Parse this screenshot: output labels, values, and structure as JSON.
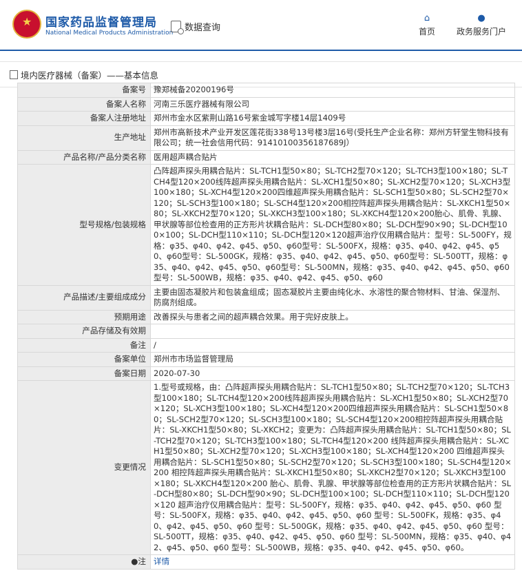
{
  "header": {
    "brand_cn": "国家药品监督管理局",
    "brand_en": "National Medical Products Administration",
    "query_label": "数据查询",
    "nav_home": "首页",
    "nav_service": "政务服务门户"
  },
  "breadcrumb": {
    "text": "境内医疗器械（备案）——基本信息"
  },
  "rows": [
    {
      "label": "备案号",
      "value": "豫郑械备20200196号"
    },
    {
      "label": "备案人名称",
      "value": "河南三乐医疗器械有限公司"
    },
    {
      "label": "备案人注册地址",
      "value": "郑州市金水区紫荆山路16号紫金城写字楼14层1409号"
    },
    {
      "label": "生产地址",
      "value": "郑州市高新技术产业开发区莲花街338号13号楼3层16号(受托生产企业名称：郑州方轩堂生物科技有限公司；统一社会信用代码：91410100356187689J）"
    },
    {
      "label": "产品名称/产品分类名称",
      "value": "医用超声耦合贴片"
    },
    {
      "label": "型号规格/包装规格",
      "value": "凸阵超声探头用耦合贴片：SL-TCH1型50×80；SL-TCH2型70×120；SL-TCH3型100×180；SL-TCH4型120×200线阵超声探头用耦合贴片：SL-XCH1型50×80；SL-XCH2型70×120；SL-XCH3型100×180；SL-XCH4型120×200四维超声探头用耦合贴片：SL-SCH1型50×80；SL-SCH2型70×120；SL-SCH3型100×180；SL-SCH4型120×200相控阵超声探头用耦合贴片：SL-XKCH1型50×80；SL-XKCH2型70×120；SL-XKCH3型100×180；SL-XKCH4型120×200胎心、肌骨、乳腺、甲状腺等部位检查用的正方形片状耦合贴片：SL-DCH型80×80；SL-DCH型90×90；SL-DCH型100×100；SL-DCH型110×110；SL-DCH型120×120超声治疗仪用耦合贴片：型号：SL-500FY，规格：φ35、φ40、φ42、φ45、φ50、φ60型号：SL-500FX，规格：φ35、φ40、φ42、φ45、φ50、φ60型号：SL-500GK，规格：φ35、φ40、φ42、φ45、φ50、φ60型号：SL-500TT，规格：φ35、φ40、φ42、φ45、φ50、φ60型号：SL-500MN，规格：φ35、φ40、φ42、φ45、φ50、φ60型号：SL-500WB，规格：φ35、φ40、φ42、φ45、φ50、φ60"
    },
    {
      "label": "产品描述/主要组成成分",
      "value": "主要由固态凝胶片和包装盒组成；固态凝胶片主要由纯化水、水溶性的聚合物材料、甘油、保湿剂、防腐剂组成。"
    },
    {
      "label": "预期用途",
      "value": "改善探头与患者之间的超声耦合效果。用于完好皮肤上。"
    },
    {
      "label": "产品存储及有效期",
      "value": ""
    },
    {
      "label": "备注",
      "value": "/"
    },
    {
      "label": "备案单位",
      "value": "郑州市市场监督管理局"
    },
    {
      "label": "备案日期",
      "value": "2020-07-30"
    },
    {
      "label": "变更情况",
      "value": "1.型号或规格，由：凸阵超声探头用耦合贴片：SL-TCH1型50×80；SL-TCH2型70×120；SL-TCH3型100×180；SL-TCH4型120×200线阵超声探头用耦合贴片：SL-XCH1型50×80；SL-XCH2型70×120；SL-XCH3型100×180；SL-XCH4型120×200四维超声探头用耦合贴片：SL-SCH1型50×80；SL-SCH2型70×120；SL-SCH3型100×180；SL-SCH4型120×200相控阵超声探头用耦合贴片：SL-XKCH1型50×80；SL-XKCH2；变更为：凸阵超声探头用耦合贴片：SL-TCH1型50×80；SL-TCH2型70×120；SL-TCH3型100×180；SL-TCH4型120×200 线阵超声探头用耦合贴片：SL-XCH1型50×80；SL-XCH2型70×120；SL-XCH3型100×180；SL-XCH4型120×200 四维超声探头用耦合贴片：SL-SCH1型50×80；SL-SCH2型70×120；SL-SCH3型100×180；SL-SCH4型120×200 相控阵超声探头用耦合贴片：SL-XKCH1型50×80；SL-XKCH2型70×120；SL-XKCH3型100×180；SL-XKCH4型120×200 胎心、肌骨、乳腺、甲状腺等部位检查用的正方形片状耦合贴片：SL-DCH型80×80；SL-DCH型90×90；SL-DCH型100×100；SL-DCH型110×110；SL-DCH型120×120 超声治疗仪用耦合贴片：型号：SL-500FY，规格：φ35、φ40、φ42、φ45、φ50、φ60 型号：SL-500FX，规格：φ35、φ40、φ42、φ45、φ50、φ60 型号：SL-500FK，规格：φ35、φ40、φ42、φ45、φ50、φ60 型号：SL-500GK，规格：φ35、φ40、φ42、φ45、φ50、φ60 型号：SL-500TT，规格：φ35、φ40、φ42、φ45、φ50、φ60 型号：SL-500MN，规格：φ35、φ40、φ42、φ45、φ50、φ60 型号：SL-500WB，规格：φ35、φ40、φ42、φ45、φ50、φ60。"
    }
  ],
  "note_row": {
    "label": "注",
    "value": "详情"
  }
}
